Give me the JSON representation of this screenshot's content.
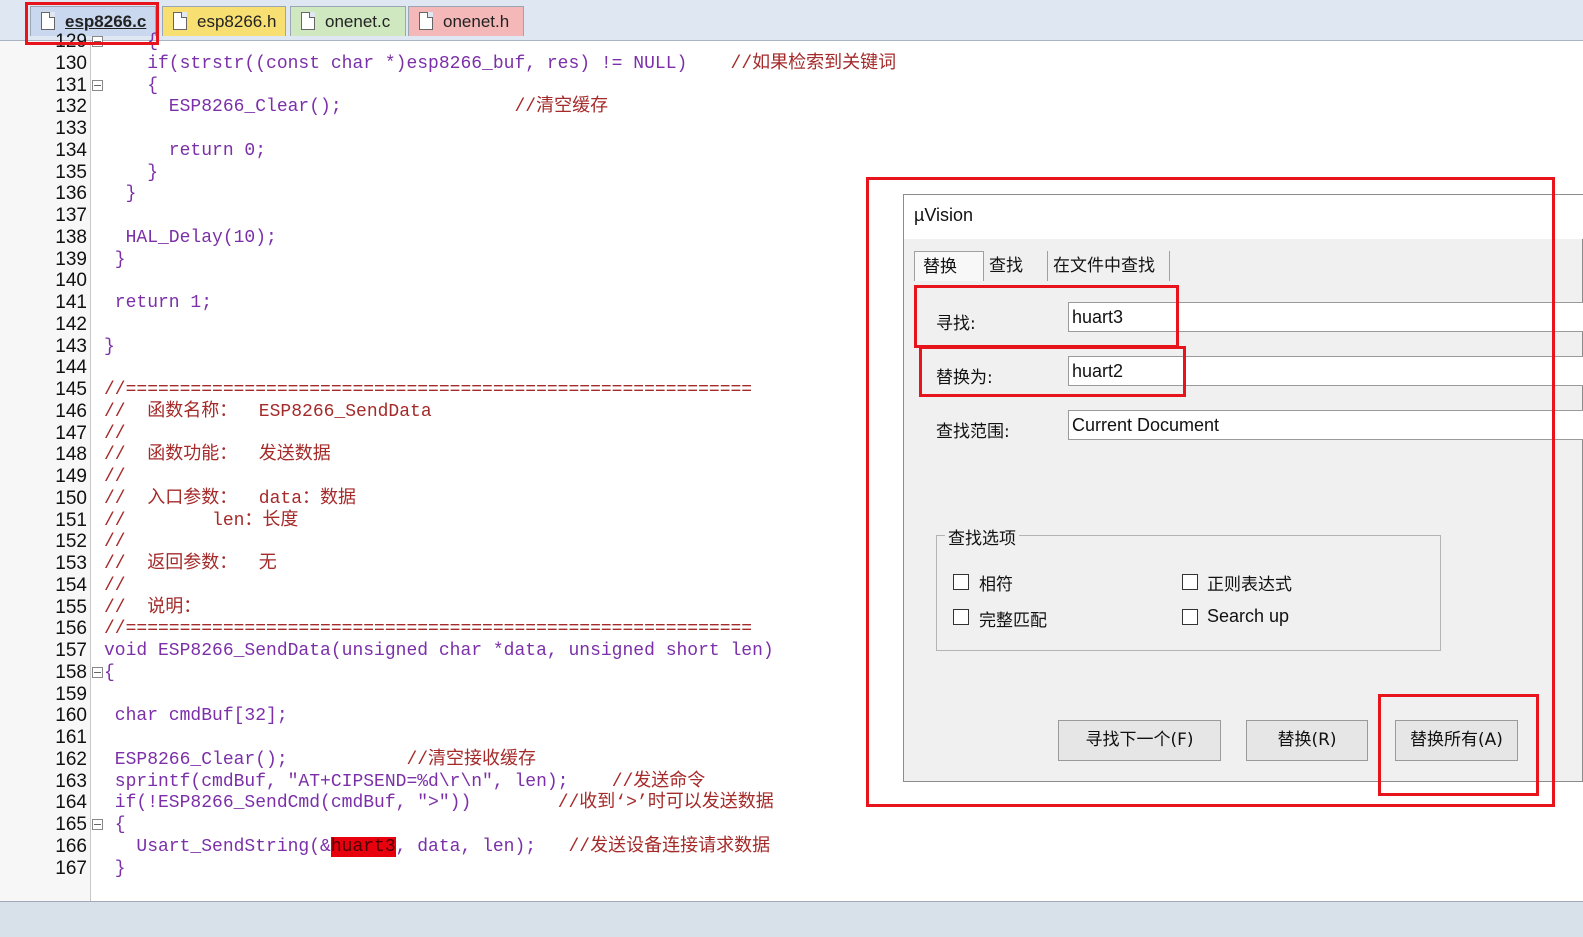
{
  "file_tabs": [
    {
      "label": "esp8266.c",
      "color": "#c9d8ee"
    },
    {
      "label": "esp8266.h",
      "color": "#f7df72"
    },
    {
      "label": "onenet.c",
      "color": "#cfe8c0"
    },
    {
      "label": "onenet.h",
      "color": "#f4b8b8"
    }
  ],
  "editor": {
    "lines": [
      {
        "num": "129",
        "code": "    {",
        "fold": true
      },
      {
        "num": "130",
        "code": "    if(strstr((const char *)esp8266_buf, res) != NULL)    ",
        "comment": "//如果检索到关键词"
      },
      {
        "num": "131",
        "code": "    {",
        "fold": true
      },
      {
        "num": "132",
        "code": "      ESP8266_Clear();                ",
        "comment": "//清空缓存"
      },
      {
        "num": "133",
        "code": ""
      },
      {
        "num": "134",
        "code": "      return 0;"
      },
      {
        "num": "135",
        "code": "    }"
      },
      {
        "num": "136",
        "code": "  }"
      },
      {
        "num": "137",
        "code": ""
      },
      {
        "num": "138",
        "code": "  HAL_Delay(10);"
      },
      {
        "num": "139",
        "code": " }"
      },
      {
        "num": "140",
        "code": ""
      },
      {
        "num": "141",
        "code": " return 1;"
      },
      {
        "num": "142",
        "code": ""
      },
      {
        "num": "143",
        "code": "}"
      },
      {
        "num": "144",
        "code": ""
      },
      {
        "num": "145",
        "code": "",
        "comment": "//=========================================================="
      },
      {
        "num": "146",
        "code": "",
        "comment": "//  函数名称：  ESP8266_SendData"
      },
      {
        "num": "147",
        "code": "",
        "comment": "//"
      },
      {
        "num": "148",
        "code": "",
        "comment": "//  函数功能：  发送数据"
      },
      {
        "num": "149",
        "code": "",
        "comment": "//"
      },
      {
        "num": "150",
        "code": "",
        "comment": "//  入口参数：  data：数据"
      },
      {
        "num": "151",
        "code": "",
        "comment": "//        len：长度"
      },
      {
        "num": "152",
        "code": "",
        "comment": "//"
      },
      {
        "num": "153",
        "code": "",
        "comment": "//  返回参数：  无"
      },
      {
        "num": "154",
        "code": "",
        "comment": "//"
      },
      {
        "num": "155",
        "code": "",
        "comment": "//  说明："
      },
      {
        "num": "156",
        "code": "",
        "comment": "//=========================================================="
      },
      {
        "num": "157",
        "code": "void ESP8266_SendData(unsigned char *data, unsigned short len)"
      },
      {
        "num": "158",
        "code": "{",
        "fold": true
      },
      {
        "num": "159",
        "code": ""
      },
      {
        "num": "160",
        "code": " char cmdBuf[32];"
      },
      {
        "num": "161",
        "code": ""
      },
      {
        "num": "162",
        "code": " ESP8266_Clear();           ",
        "comment": "//清空接收缓存"
      },
      {
        "num": "163",
        "code": " sprintf(cmdBuf, \"AT+CIPSEND=%d\\r\\n\", len);    ",
        "comment": "//发送命令"
      },
      {
        "num": "164",
        "code": " if(!ESP8266_SendCmd(cmdBuf, \">\"))        ",
        "comment": "//收到‘>’时可以发送数据"
      },
      {
        "num": "165",
        "code": " {",
        "fold": true
      },
      {
        "num": "166",
        "code": "   Usart_SendString(&",
        "highlight": "huart3",
        "code_after": ", data, len);   ",
        "comment": "//发送设备连接请求数据"
      },
      {
        "num": "167",
        "code": " }"
      }
    ]
  },
  "dialog": {
    "title": "µVision",
    "tabs": [
      "替换",
      "查找",
      "在文件中查找"
    ],
    "find_label": "寻找:",
    "find_value": "huart3",
    "replace_label": "替换为:",
    "replace_value": "huart2",
    "scope_label": "查找范围:",
    "scope_value": "Current Document",
    "options_title": "查找选项",
    "options": [
      {
        "label": "相符",
        "checked": false
      },
      {
        "label": "正则表达式",
        "checked": false
      },
      {
        "label": "完整匹配",
        "checked": false
      },
      {
        "label": "Search up",
        "checked": false
      }
    ],
    "buttons": {
      "find_next": "寻找下一个(F)",
      "replace": "替换(R)",
      "replace_all": "替换所有(A)"
    }
  },
  "colors": {
    "annotation_red": "#e8141c",
    "code_purple": "#7b2fa8",
    "comment_brown": "#a52a2a",
    "highlight_red": "#e8000e"
  }
}
